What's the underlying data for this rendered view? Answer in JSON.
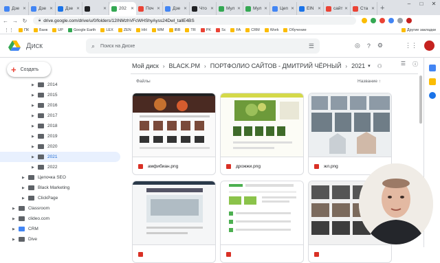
{
  "browser": {
    "tabs": [
      {
        "label": "Дзе",
        "color": "#4285f4"
      },
      {
        "label": "Дзе",
        "color": "#4285f4"
      },
      {
        "label": "Дзе",
        "color": "#1a73e8"
      },
      {
        "label": "",
        "color": "#202124"
      },
      {
        "label": "202",
        "color": "#34a853",
        "active": true
      },
      {
        "label": "Поч",
        "color": "#ea4335"
      },
      {
        "label": "Дзе",
        "color": "#4285f4"
      },
      {
        "label": "Что",
        "color": "#202124"
      },
      {
        "label": "Мул",
        "color": "#34a853"
      },
      {
        "label": "Мул",
        "color": "#34a853"
      },
      {
        "label": "Цеп",
        "color": "#4285f4"
      },
      {
        "label": "ElN",
        "color": "#1a73e8"
      },
      {
        "label": "сайт",
        "color": "#ea4335"
      },
      {
        "label": "Ста",
        "color": "#ea4335"
      }
    ],
    "url": "drive.google.com/drive/u/0/folders/12INMzhVFcWHShyAyss24Dwl_tallE4BS",
    "bookmarks": [
      {
        "label": "ПК",
        "color": "#fbbc04"
      },
      {
        "label": "Банк",
        "color": "#fbbc04"
      },
      {
        "label": "UP",
        "color": "#fbbc04"
      },
      {
        "label": "Google Earth",
        "color": "#34a853"
      },
      {
        "label": "LEX",
        "color": "#fbbc04"
      },
      {
        "label": "ZEN",
        "color": "#fbbc04"
      },
      {
        "label": "HH",
        "color": "#fbbc04"
      },
      {
        "label": "WM",
        "color": "#fbbc04"
      },
      {
        "label": "IBB",
        "color": "#fbbc04"
      },
      {
        "label": "TR",
        "color": "#fbbc04"
      },
      {
        "label": "PK",
        "color": "#ea4335"
      },
      {
        "label": "Sc",
        "color": "#ea4335"
      },
      {
        "label": "FA",
        "color": "#fbbc04"
      },
      {
        "label": "CRM",
        "color": "#fbbc04"
      },
      {
        "label": "Work",
        "color": "#fbbc04"
      },
      {
        "label": "Обучение",
        "color": "#fbbc04"
      }
    ],
    "bookmarks_other": "Другие закладки"
  },
  "header": {
    "brand": "Диск",
    "search_placeholder": "Поиск на Диске"
  },
  "sidebar": {
    "create_label": "Создать",
    "tree": [
      {
        "label": "2014",
        "indent": 3,
        "arrow": "▶"
      },
      {
        "label": "2015",
        "indent": 3,
        "arrow": "▶"
      },
      {
        "label": "2016",
        "indent": 3,
        "arrow": "▶"
      },
      {
        "label": "2017",
        "indent": 3,
        "arrow": "▶"
      },
      {
        "label": "2018",
        "indent": 3,
        "arrow": "▶"
      },
      {
        "label": "2019",
        "indent": 3,
        "arrow": "▶"
      },
      {
        "label": "2020",
        "indent": 3,
        "arrow": "▶"
      },
      {
        "label": "2021",
        "indent": 3,
        "arrow": "▶",
        "selected": true
      },
      {
        "label": "2022",
        "indent": 3,
        "arrow": "▶"
      },
      {
        "label": "Цепочка SEO",
        "indent": 2,
        "arrow": "▶"
      },
      {
        "label": "Black Marketing",
        "indent": 2,
        "arrow": "▶"
      },
      {
        "label": "ClickPage",
        "indent": 2,
        "arrow": "▶"
      },
      {
        "label": "Classroom",
        "indent": 1,
        "arrow": "▶"
      },
      {
        "label": "clideo.com",
        "indent": 1,
        "arrow": "▶"
      },
      {
        "label": "CRM",
        "indent": 1,
        "arrow": "▶",
        "blue": true
      },
      {
        "label": "Dive",
        "indent": 1,
        "arrow": "▶"
      }
    ]
  },
  "breadcrumb": [
    "Мой диск",
    "BLACK.PM",
    "ПОРТФОЛИО САЙТОВ - ДМИТРИЙ ЧЁРНЫЙ",
    "2021"
  ],
  "main": {
    "files_label": "Файлы",
    "sort_label": "Название"
  },
  "files": [
    {
      "name": "амфибиан.png"
    },
    {
      "name": "дрожжи.png"
    },
    {
      "name": "жл.png"
    },
    {
      "name": ""
    },
    {
      "name": ""
    },
    {
      "name": ""
    }
  ]
}
